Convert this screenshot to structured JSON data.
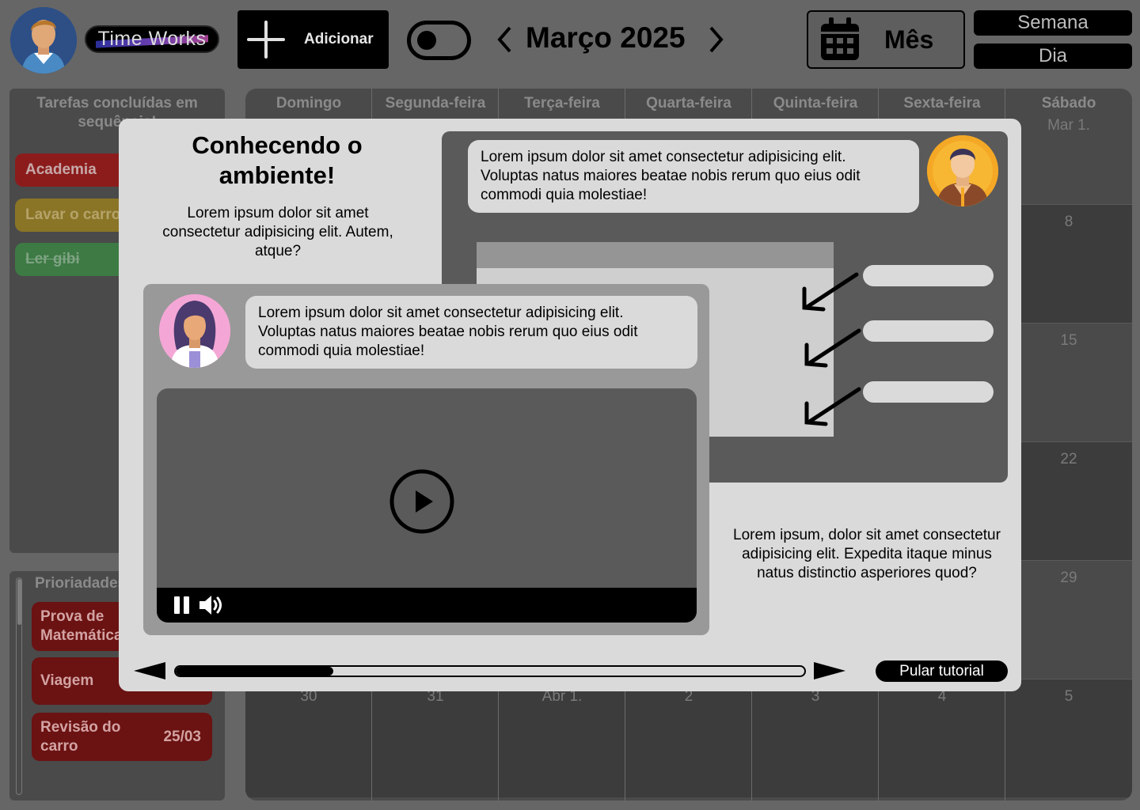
{
  "header": {
    "brand": "Time Works",
    "add_label": "Adicionar",
    "month_title": "Março 2025",
    "view_month": "Mês",
    "view_week": "Semana",
    "view_day": "Dia"
  },
  "sidebar": {
    "done_title": "Tarefas concluídas em sequência!",
    "done_tasks": [
      {
        "label": "Academia",
        "color": "#8c1c1c"
      },
      {
        "label": "Lavar o carro",
        "color": "#8a7526"
      },
      {
        "label": "Ler gibi",
        "color": "#3d7a44"
      }
    ],
    "priority_title": "Prioriadades",
    "priorities": [
      {
        "label": "Prova de Matemática",
        "date": ""
      },
      {
        "label": "Viagem",
        "date": ""
      },
      {
        "label": "Revisão do carro",
        "date": "25/03"
      }
    ]
  },
  "calendar": {
    "weekdays": [
      "Domingo",
      "Segunda-feira",
      "Terça-feira",
      "Quarta-feira",
      "Quinta-feira",
      "Sexta-feira",
      "Sábado"
    ],
    "visible_days": [
      "Mar 1.",
      "8",
      "15",
      "22",
      "29",
      "30",
      "31",
      "Abr 1.",
      "2",
      "3",
      "4",
      "5"
    ]
  },
  "tutorial": {
    "title": "Conhecendo o ambiente!",
    "intro": "Lorem ipsum dolor sit amet consectetur adipisicing elit. Autem, atque?",
    "bubble_right": "Lorem ipsum dolor sit amet consectetur adipisicing elit. Voluptas natus maiores beatae nobis rerum quo eius odit commodi quia molestiae!",
    "bubble_left": "Lorem ipsum dolor sit amet consectetur adipisicing elit. Voluptas natus maiores beatae nobis rerum quo eius odit commodi quia molestiae!",
    "description": "Lorem ipsum, dolor sit amet consectetur adipisicing elit. Expedita itaque minus natus distinctio asperiores quod?",
    "skip_label": "Pular tutorial",
    "progress": 0.25
  }
}
